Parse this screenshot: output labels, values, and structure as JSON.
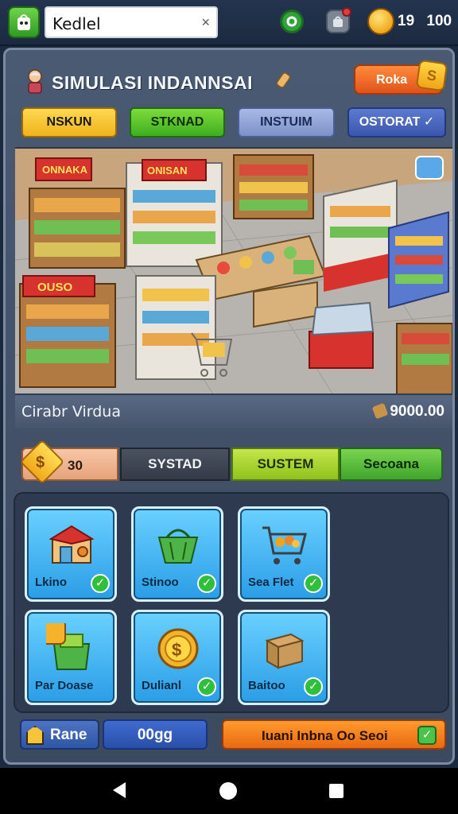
{
  "topbar": {
    "search_value": "Kedlel",
    "close_glyph": "×",
    "coins": [
      "19",
      "100"
    ],
    "icons": [
      "app-icon",
      "shop-icon",
      "bag-icon",
      "coin-icon"
    ]
  },
  "header": {
    "title": "SIMULASI INDANNSAI",
    "play_label": "Roka",
    "play_chip": "S"
  },
  "tabs": [
    {
      "label": "NSKUN"
    },
    {
      "label": "STKNAD"
    },
    {
      "label": "INSTUIM"
    },
    {
      "label": "OSTORAT ✓"
    }
  ],
  "scene": {
    "signs": [
      "ONNAKA",
      "ONISAN",
      "OUSO"
    ]
  },
  "info": {
    "left": "Cirabr Virdua",
    "right": "9000.00"
  },
  "segments": {
    "badge_glyph": "$",
    "badge_value": "30",
    "items": [
      "SYSTAD",
      "SUSTEM",
      "Secoana"
    ]
  },
  "cards": [
    {
      "label": "Lkino",
      "icon": "shop-building-icon"
    },
    {
      "label": "Stinoo",
      "icon": "basket-icon"
    },
    {
      "label": "Sea Flet",
      "icon": "shopping-cart-icon"
    },
    {
      "label": "Par Doase",
      "icon": "green-crate-icon"
    },
    {
      "label": "Dulianl",
      "icon": "gold-coin-icon"
    },
    {
      "label": "Baitoo",
      "icon": "cardboard-box-icon"
    }
  ],
  "bottom": {
    "rank_label": "Rane",
    "value": "00gg",
    "cta_label": "Iuani Inbna Oo Seoi",
    "cta_glyph": "✓"
  },
  "colors": {
    "panel": "#4a5a73",
    "accent_orange": "#e86a12",
    "accent_green": "#3fae1f",
    "accent_blue": "#2a9de6"
  }
}
